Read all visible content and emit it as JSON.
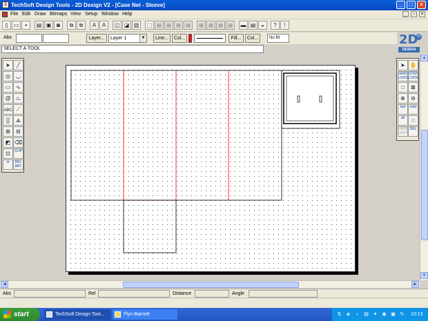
{
  "window": {
    "title": "TechSoft Design Tools - 2D Design V2 - [Case Net - Sleeve]",
    "app_icon_letter": "2"
  },
  "menubar": {
    "items": [
      "File",
      "Edit",
      "Draw",
      "Bitmaps",
      "View",
      "Setup",
      "Window",
      "Help"
    ]
  },
  "toolbar2": {
    "abs_label": "Abs",
    "layer_button": "Layer...",
    "layer_value": "Layer 1",
    "line_button": "Line...",
    "col_button": "Col...",
    "fill_button": "Fill...",
    "col2_button": "Col...",
    "fill_value": "No fill",
    "accent_color": "#ff0000"
  },
  "prompt": "SELECT A TOOL",
  "logo": {
    "text": "2D",
    "version": "V2",
    "caption": "DESIGN",
    "color": "#3a6db0"
  },
  "left_palette": {
    "text_tool": "ABC",
    "clip_label": "CLIP",
    "del_art_label": "DEL ART",
    "in_label": "in"
  },
  "right_palette": {
    "grid_lock": "GRID LOCK",
    "step_lock": "STEP LOCK",
    "last": "last",
    "redo": "redo",
    "all": "all",
    "undo_last": "UNDO LAST",
    "del": "DEL"
  },
  "coordbar": {
    "abs": "Abs",
    "rel": "Rel",
    "distance": "Distance",
    "angle": "Angle"
  },
  "taskbar": {
    "start": "start",
    "items": [
      "TechSoft Design Tool...",
      "Flyn Barnett"
    ],
    "clock": "10:13"
  },
  "drawing": {
    "outline_color": "#000000",
    "fold_line_color": "#ff0000"
  }
}
